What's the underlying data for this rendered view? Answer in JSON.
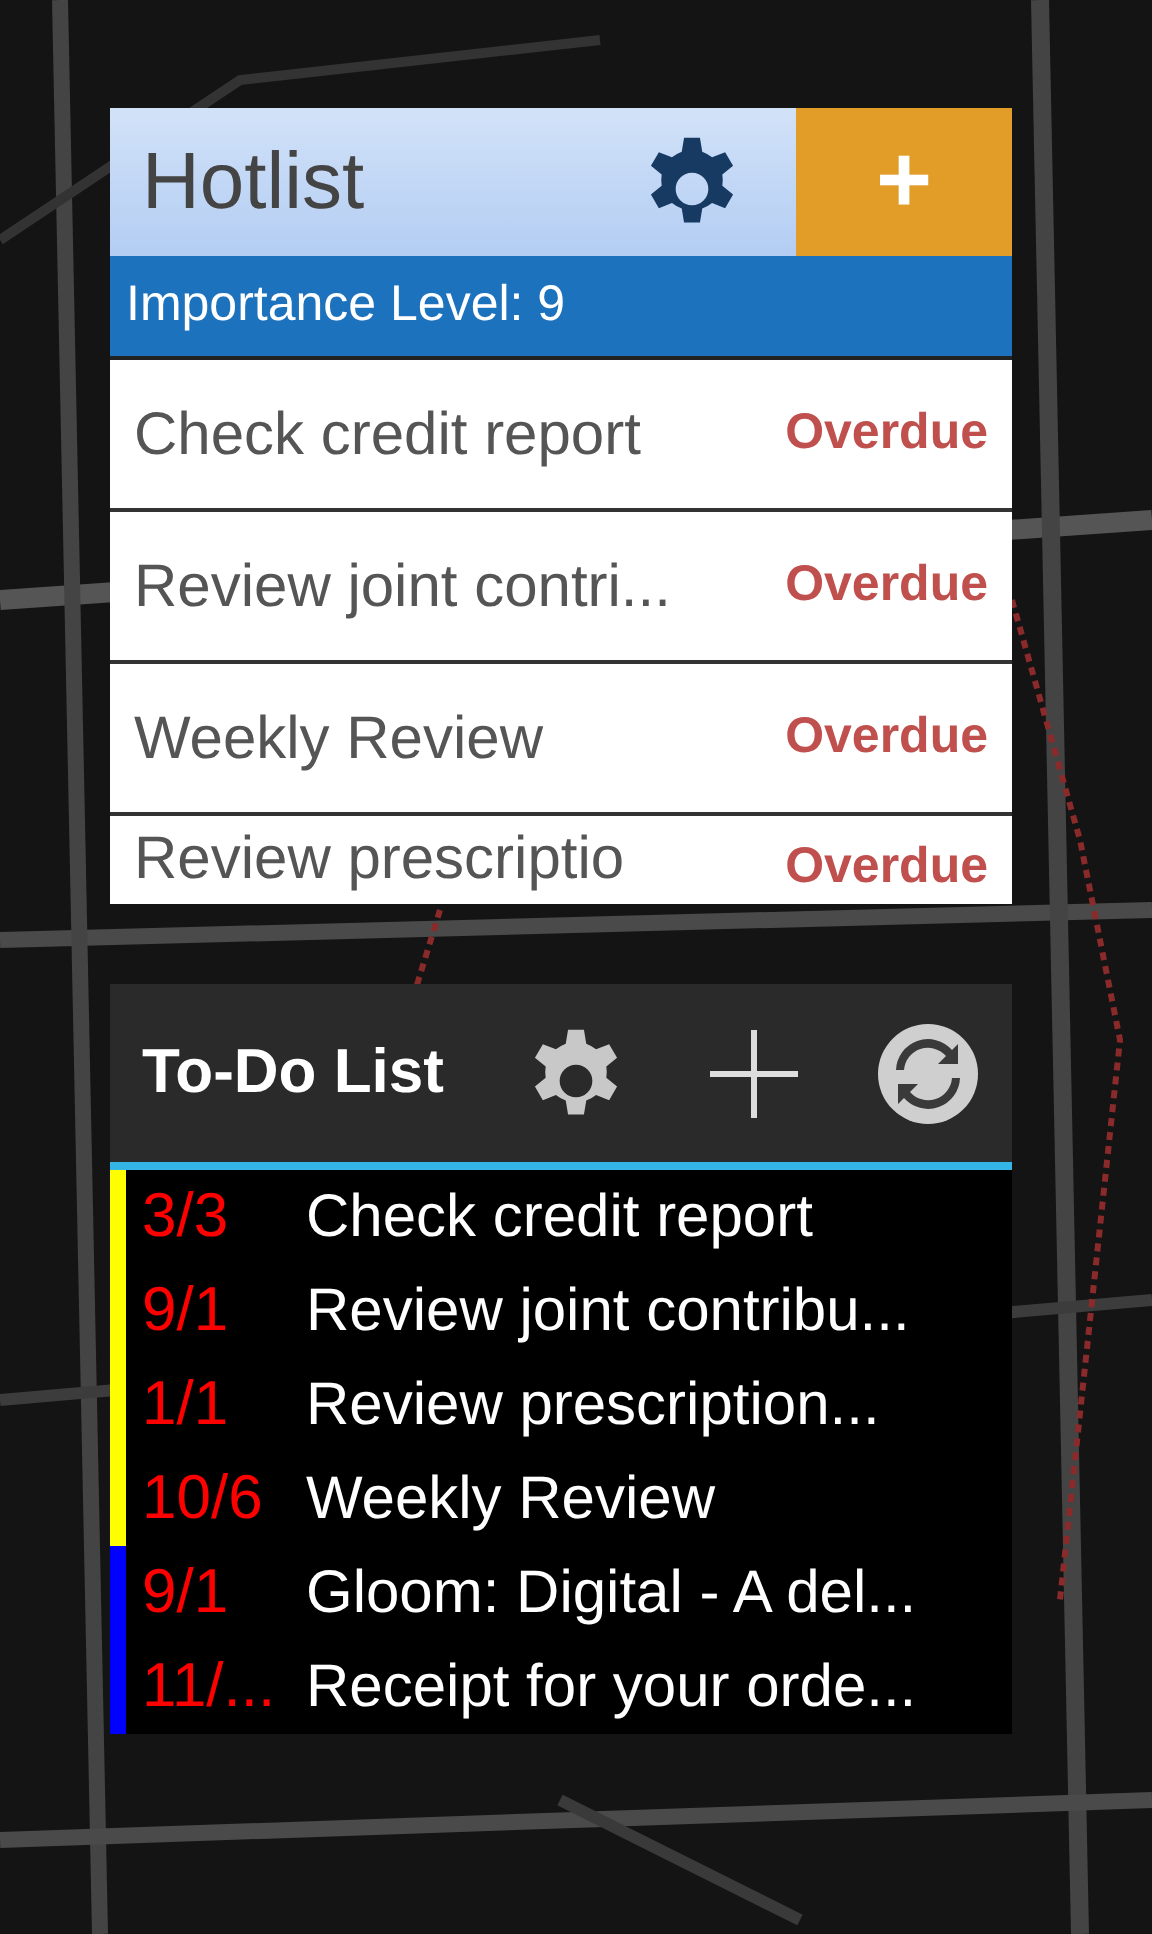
{
  "hotlist": {
    "title": "Hotlist",
    "add_label": "+",
    "importance": "Importance Level: 9",
    "items": [
      {
        "title": "Check credit report",
        "status": "Overdue"
      },
      {
        "title": "Review joint contri...",
        "status": "Overdue"
      },
      {
        "title": "Weekly Review",
        "status": "Overdue"
      },
      {
        "title": "Review prescriptio",
        "status": "Overdue"
      }
    ]
  },
  "todo": {
    "title": "To-Do List",
    "items": [
      {
        "date": "3/3",
        "title": "Check credit report",
        "color": "#ffff00"
      },
      {
        "date": "9/1",
        "title": "Review joint contribu...",
        "color": "#ffff00"
      },
      {
        "date": "1/1",
        "title": "Review prescription...",
        "color": "#ffff00"
      },
      {
        "date": "10/6",
        "title": "Weekly Review",
        "color": "#ffff00"
      },
      {
        "date": "9/1",
        "title": "Gloom: Digital - A del...",
        "color": "#0000ff"
      },
      {
        "date": "11/...",
        "title": "Receipt for your orde...",
        "color": "#0000ff"
      }
    ]
  }
}
